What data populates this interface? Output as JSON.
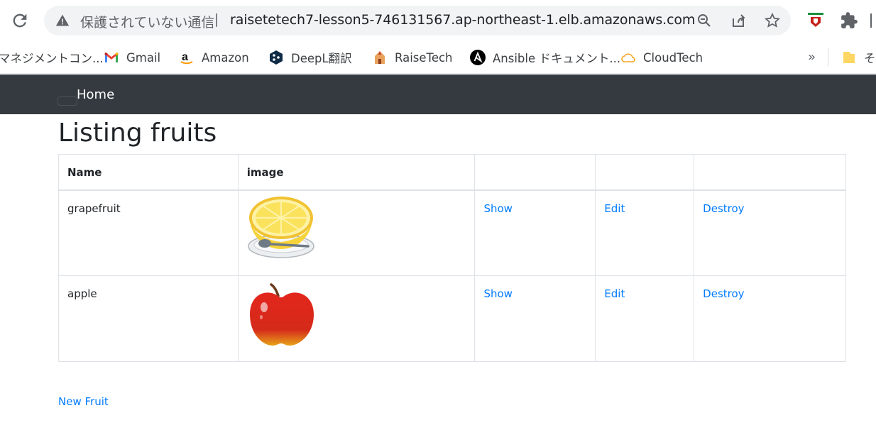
{
  "browser": {
    "security_label": "保護されていない通信",
    "separator": "|",
    "url": "raisetetech7-lesson5-746131567.ap-northeast-1.elb.amazonaws.com"
  },
  "bookmarks": [
    {
      "label": "マネジメントコン...",
      "icon": "aws-icon"
    },
    {
      "label": "Gmail",
      "icon": "gmail-icon"
    },
    {
      "label": "Amazon",
      "icon": "amazon-icon"
    },
    {
      "label": "DeepL翻訳",
      "icon": "deepl-icon"
    },
    {
      "label": "RaiseTech",
      "icon": "raisetech-icon"
    },
    {
      "label": "Ansible ドキュメント...",
      "icon": "ansible-icon"
    },
    {
      "label": "CloudTech",
      "icon": "cloudtech-icon"
    },
    {
      "label": "そ",
      "icon": "folder-icon"
    }
  ],
  "bookmarks_more": "»",
  "nav": {
    "home": "Home"
  },
  "page": {
    "title": "Listing fruits",
    "new_link": "New Fruit"
  },
  "table": {
    "headers": [
      "Name",
      "image",
      "",
      "",
      ""
    ],
    "rows": [
      {
        "name": "grapefruit",
        "image": "grapefruit-image",
        "show": "Show",
        "edit": "Edit",
        "destroy": "Destroy"
      },
      {
        "name": "apple",
        "image": "apple-image",
        "show": "Show",
        "edit": "Edit",
        "destroy": "Destroy"
      }
    ]
  },
  "colors": {
    "navbar": "#343a40",
    "link": "#007bff",
    "border": "#dee2e6"
  }
}
